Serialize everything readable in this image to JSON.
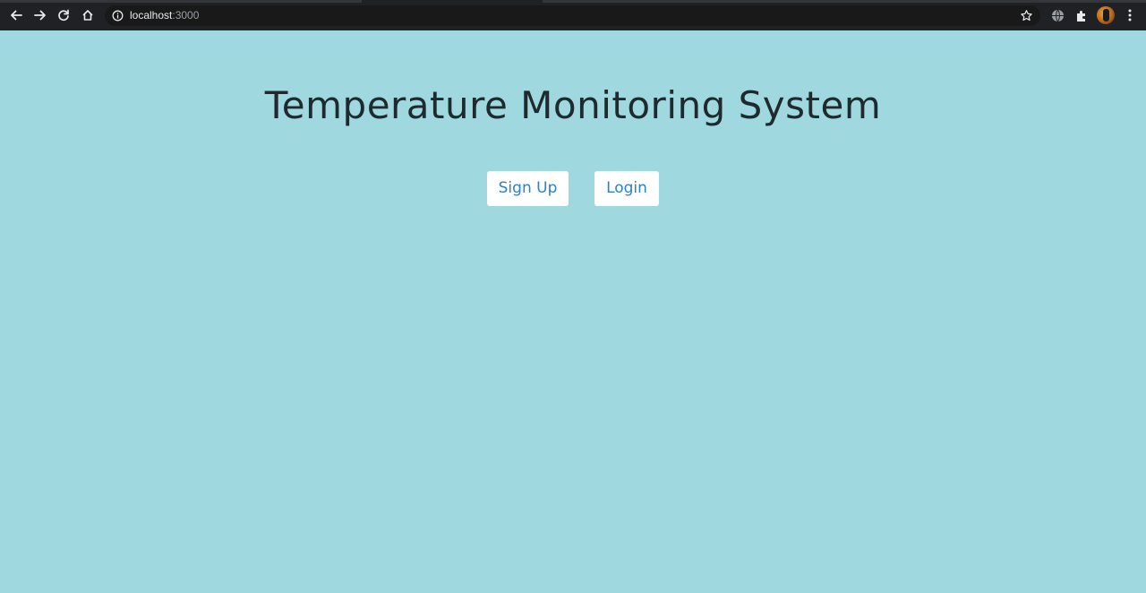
{
  "browser": {
    "url_host": "localhost",
    "url_port": ":3000",
    "icons": [
      "back-arrow-icon",
      "forward-arrow-icon",
      "reload-icon",
      "home-icon",
      "site-info-icon",
      "bookmark-star-icon",
      "globe-icon",
      "extensions-puzzle-icon",
      "profile-avatar",
      "kebab-menu-icon"
    ],
    "colors": {
      "toolbar": "#202124",
      "omnibox": "#191919"
    }
  },
  "page": {
    "title": "Temperature Monitoring System",
    "signup_label": "Sign Up",
    "login_label": "Login",
    "colors": {
      "background": "#a0d8e0",
      "button_text": "#2b82c9",
      "title_text": "#1f2a2e"
    }
  }
}
